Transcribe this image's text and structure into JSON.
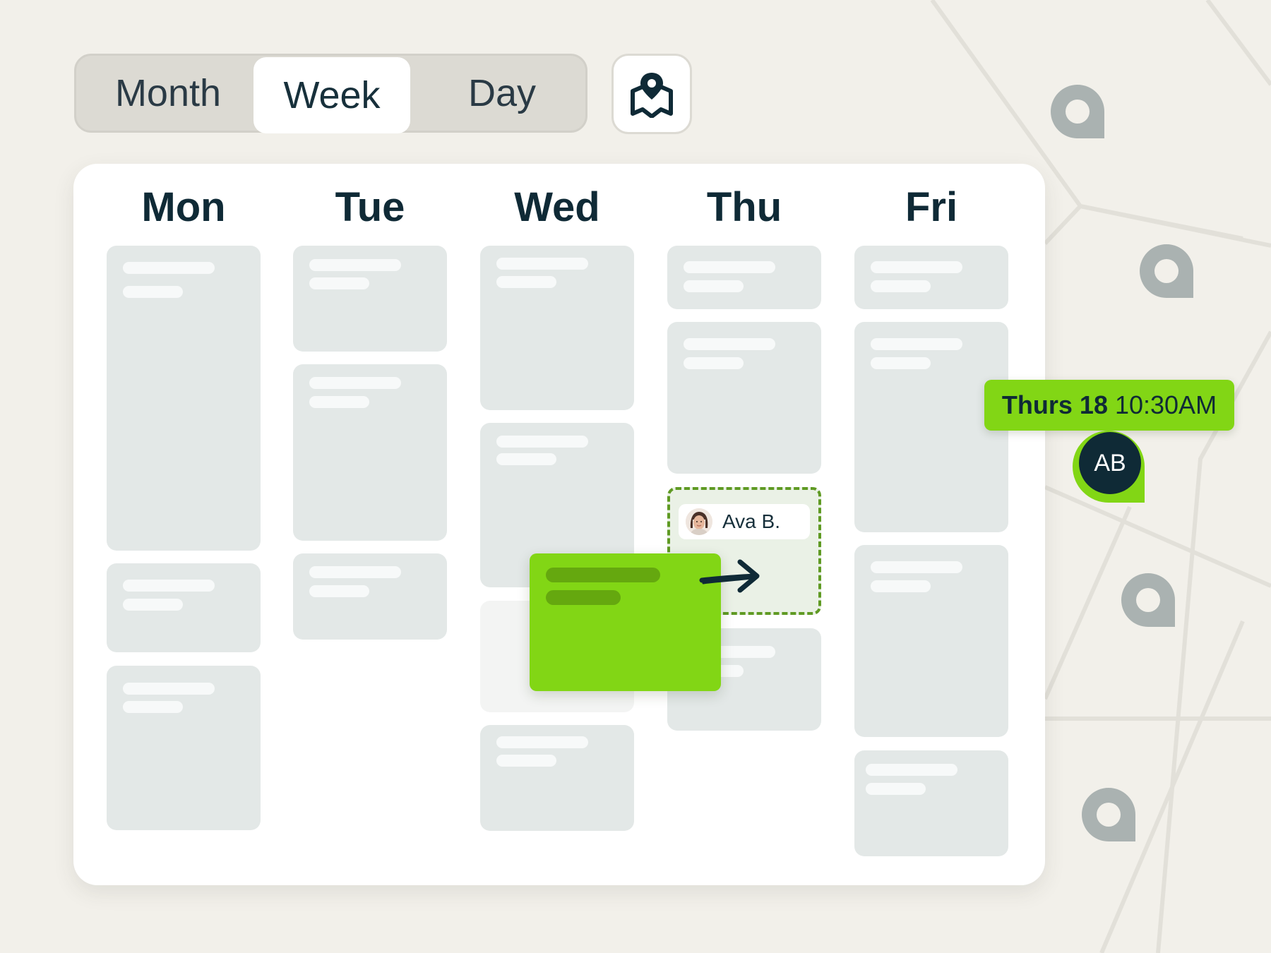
{
  "view_switcher": {
    "tabs": [
      {
        "label": "Month",
        "active": false
      },
      {
        "label": "Week",
        "active": true
      },
      {
        "label": "Day",
        "active": false
      }
    ],
    "map_button_icon": "map-pin-icon"
  },
  "calendar": {
    "days": [
      "Mon",
      "Tue",
      "Wed",
      "Thu",
      "Fri"
    ]
  },
  "drag": {
    "assignee_name": "Ava B.",
    "arrow_icon": "arrow-right-icon"
  },
  "appointment": {
    "day": "Thurs 18",
    "time": "10:30AM",
    "avatar_initials": "AB"
  },
  "colors": {
    "accent_green": "#82d615",
    "dark_navy": "#0f2a36",
    "placeholder_grey": "#e3e8e7",
    "background": "#f2f0ea",
    "map_pin_grey": "#aab2b1"
  }
}
